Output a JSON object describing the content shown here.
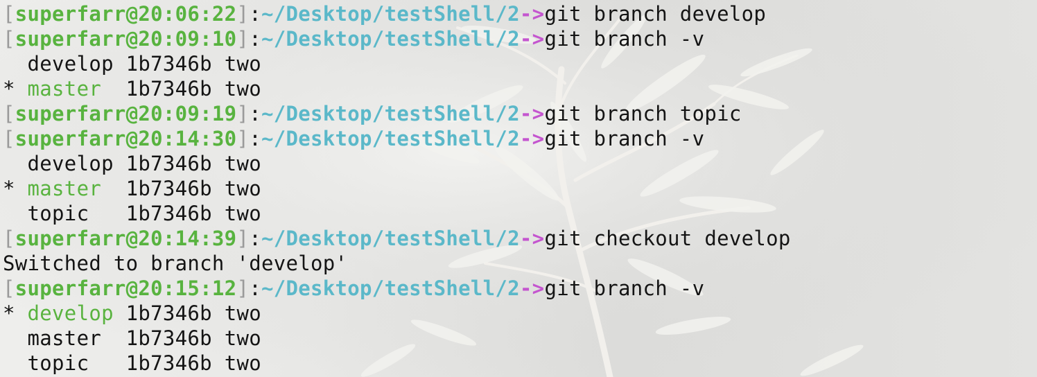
{
  "prompt_style": {
    "user_color": "#58b33f",
    "path_color": "#5bb8c9",
    "arrow_color": "#c455cf",
    "bracket_color": "#9a9a9a",
    "text_color": "#141414"
  },
  "prompts": [
    {
      "user_time": "superfarr@20:06:22",
      "path": "~/Desktop/testShell/2",
      "arrow": "->",
      "command": "git branch develop"
    },
    {
      "user_time": "superfarr@20:09:10",
      "path": "~/Desktop/testShell/2",
      "arrow": "->",
      "command": "git branch -v"
    },
    {
      "user_time": "superfarr@20:09:19",
      "path": "~/Desktop/testShell/2",
      "arrow": "->",
      "command": "git branch topic"
    },
    {
      "user_time": "superfarr@20:14:30",
      "path": "~/Desktop/testShell/2",
      "arrow": "->",
      "command": "git branch -v"
    },
    {
      "user_time": "superfarr@20:14:39",
      "path": "~/Desktop/testShell/2",
      "arrow": "->",
      "command": "git checkout develop"
    },
    {
      "user_time": "superfarr@20:15:12",
      "path": "~/Desktop/testShell/2",
      "arrow": "->",
      "command": "git branch -v"
    }
  ],
  "outputs": {
    "list1": [
      {
        "marker": " ",
        "name": "develop",
        "pad": " ",
        "hash": "1b7346b",
        "msg": "two"
      },
      {
        "marker": "*",
        "name": "master",
        "pad": "  ",
        "hash": "1b7346b",
        "msg": "two"
      }
    ],
    "list2": [
      {
        "marker": " ",
        "name": "develop",
        "pad": " ",
        "hash": "1b7346b",
        "msg": "two"
      },
      {
        "marker": "*",
        "name": "master",
        "pad": "  ",
        "hash": "1b7346b",
        "msg": "two"
      },
      {
        "marker": " ",
        "name": "topic",
        "pad": "   ",
        "hash": "1b7346b",
        "msg": "two"
      }
    ],
    "switched_msg": "Switched to branch 'develop'",
    "list3": [
      {
        "marker": "*",
        "name": "develop",
        "pad": " ",
        "hash": "1b7346b",
        "msg": "two"
      },
      {
        "marker": " ",
        "name": "master",
        "pad": "  ",
        "hash": "1b7346b",
        "msg": "two"
      },
      {
        "marker": " ",
        "name": "topic",
        "pad": "   ",
        "hash": "1b7346b",
        "msg": "two"
      }
    ]
  }
}
